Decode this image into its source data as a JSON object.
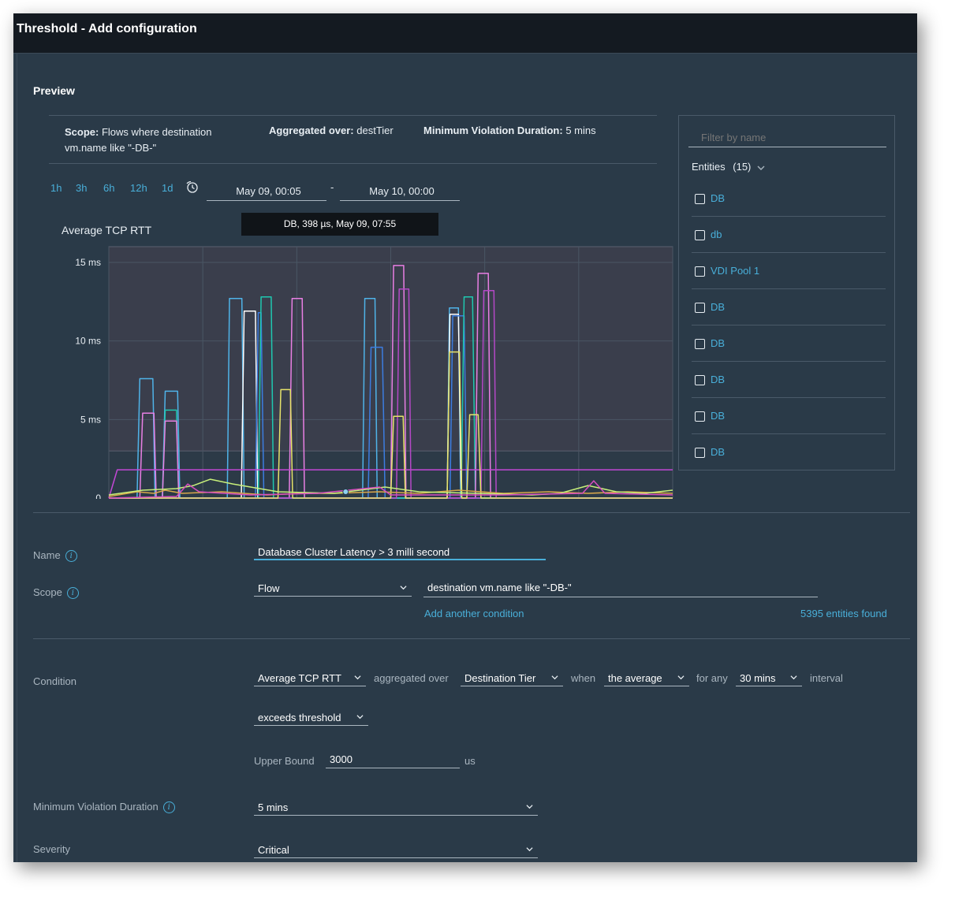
{
  "window": {
    "title": "Threshold - Add configuration"
  },
  "preview": {
    "title": "Preview",
    "summary": {
      "scope_label": "Scope:",
      "scope_value_line1": "Flows where destination",
      "scope_value_line2": "vm.name like \"-DB-\"",
      "aggregated_label": "Aggregated over:",
      "aggregated_value": "destTier",
      "min_violation_label": "Minimum Violation Duration:",
      "min_violation_value": "5 mins"
    },
    "time_ranges": [
      "1h",
      "3h",
      "6h",
      "12h",
      "1d"
    ],
    "time_icon": "clock-history-icon",
    "from_date": "May 09, 00:05",
    "range_separator": "-",
    "to_date": "May 10, 00:00",
    "tooltip": "DB, 398 µs, May 09, 07:55"
  },
  "entities": {
    "filter_placeholder": "Filter by name",
    "header_label": "Entities",
    "header_count": "(15)",
    "items": [
      {
        "label": "DB",
        "checked": false
      },
      {
        "label": "db",
        "checked": false
      },
      {
        "label": "VDI Pool 1",
        "checked": false
      },
      {
        "label": "DB",
        "checked": false
      },
      {
        "label": "DB",
        "checked": false
      },
      {
        "label": "DB",
        "checked": false
      },
      {
        "label": "DB",
        "checked": false
      },
      {
        "label": "DB",
        "checked": false
      }
    ]
  },
  "chart_data": {
    "type": "line",
    "title": "Average TCP RTT",
    "y_unit": "ms",
    "ylim": [
      0,
      16
    ],
    "y_ticks": [
      {
        "value": 0,
        "label": "0"
      },
      {
        "value": 5,
        "label": "5 ms"
      },
      {
        "value": 10,
        "label": "10 ms"
      },
      {
        "value": 15,
        "label": "15 ms"
      }
    ],
    "threshold": 3,
    "xlim": [
      0,
      100
    ],
    "grid": true,
    "series": [
      {
        "color": "#4fb3e8",
        "points": [
          [
            0,
            0
          ],
          [
            5,
            0
          ],
          [
            5.5,
            7.6
          ],
          [
            7.8,
            7.6
          ],
          [
            8.2,
            0
          ],
          [
            9.5,
            0
          ],
          [
            10,
            6.8
          ],
          [
            12.2,
            6.8
          ],
          [
            12.6,
            0
          ],
          [
            21,
            0
          ],
          [
            21.4,
            12.7
          ],
          [
            23.6,
            12.7
          ],
          [
            24,
            0
          ],
          [
            45,
            0
          ],
          [
            45.4,
            12.7
          ],
          [
            47.2,
            12.7
          ],
          [
            47.6,
            0
          ],
          [
            60,
            0
          ],
          [
            60.4,
            12.1
          ],
          [
            62,
            12.1
          ],
          [
            62.4,
            0
          ],
          [
            100,
            0
          ]
        ]
      },
      {
        "color": "#ffffff",
        "points": [
          [
            0,
            0
          ],
          [
            23.5,
            0
          ],
          [
            24,
            11.9
          ],
          [
            26,
            11.9
          ],
          [
            26.4,
            0
          ],
          [
            60,
            0
          ],
          [
            60.5,
            11.7
          ],
          [
            62,
            11.7
          ],
          [
            62.5,
            0
          ],
          [
            100,
            0
          ]
        ]
      },
      {
        "color": "#3c7de0",
        "points": [
          [
            0,
            0
          ],
          [
            26,
            0
          ],
          [
            26.5,
            11.8
          ],
          [
            27,
            11.8
          ],
          [
            27.5,
            0
          ],
          [
            46,
            0
          ],
          [
            46.5,
            9.6
          ],
          [
            48.5,
            9.6
          ],
          [
            49,
            0
          ],
          [
            60.5,
            0
          ],
          [
            61,
            11.6
          ],
          [
            63,
            11.6
          ],
          [
            63.5,
            0
          ],
          [
            100,
            0
          ]
        ]
      },
      {
        "color": "#1fc8b0",
        "points": [
          [
            0,
            0
          ],
          [
            9.5,
            0
          ],
          [
            10,
            5.6
          ],
          [
            12,
            5.6
          ],
          [
            12.4,
            0
          ],
          [
            26.5,
            0
          ],
          [
            27,
            12.8
          ],
          [
            28.8,
            12.8
          ],
          [
            29.2,
            0
          ],
          [
            62.5,
            0
          ],
          [
            63,
            12.8
          ],
          [
            64.5,
            12.8
          ],
          [
            65,
            0
          ],
          [
            100,
            0
          ]
        ]
      },
      {
        "color": "#e87fe3",
        "points": [
          [
            0,
            0
          ],
          [
            5.5,
            0
          ],
          [
            6,
            5.4
          ],
          [
            8,
            5.4
          ],
          [
            8.4,
            0
          ],
          [
            9.5,
            0
          ],
          [
            10,
            4.9
          ],
          [
            12,
            4.9
          ],
          [
            12.4,
            0
          ],
          [
            32,
            0
          ],
          [
            32.5,
            12.7
          ],
          [
            34.3,
            12.7
          ],
          [
            34.7,
            0
          ],
          [
            50,
            0
          ],
          [
            50.5,
            14.8
          ],
          [
            52.3,
            14.8
          ],
          [
            52.7,
            0
          ],
          [
            65,
            0
          ],
          [
            65.5,
            14.3
          ],
          [
            67.3,
            14.3
          ],
          [
            67.7,
            0
          ],
          [
            100,
            0
          ]
        ]
      },
      {
        "color": "#c347d6",
        "points": [
          [
            0,
            0
          ],
          [
            1.5,
            1.8
          ],
          [
            100,
            1.8
          ]
        ]
      },
      {
        "color": "#b448c6",
        "points": [
          [
            0,
            0
          ],
          [
            51,
            0
          ],
          [
            51.5,
            13.3
          ],
          [
            53.2,
            13.3
          ],
          [
            53.6,
            0
          ],
          [
            66,
            0
          ],
          [
            66.5,
            13.2
          ],
          [
            68.3,
            13.2
          ],
          [
            68.7,
            0
          ],
          [
            100,
            0
          ]
        ]
      },
      {
        "color": "#e7e36a",
        "points": [
          [
            0,
            0
          ],
          [
            30,
            0
          ],
          [
            30.5,
            6.9
          ],
          [
            32.2,
            6.9
          ],
          [
            32.6,
            0
          ],
          [
            50,
            0
          ],
          [
            50.5,
            5.2
          ],
          [
            52.2,
            5.2
          ],
          [
            52.6,
            0
          ],
          [
            60,
            0
          ],
          [
            60.4,
            9.3
          ],
          [
            62.2,
            9.3
          ],
          [
            62.6,
            0
          ],
          [
            63.5,
            0
          ],
          [
            64,
            5.3
          ],
          [
            65.5,
            5.3
          ],
          [
            66,
            0
          ],
          [
            100,
            0
          ]
        ]
      },
      {
        "color": "#d9a84a",
        "points": [
          [
            0,
            0.1
          ],
          [
            5,
            0.4
          ],
          [
            8,
            0.3
          ],
          [
            10,
            0.5
          ],
          [
            13,
            0.3
          ],
          [
            20,
            0.4
          ],
          [
            28,
            0.2
          ],
          [
            34,
            0.3
          ],
          [
            40,
            0.3
          ],
          [
            48,
            0.4
          ],
          [
            55,
            0.3
          ],
          [
            62,
            0.5
          ],
          [
            70,
            0.3
          ],
          [
            78,
            0.4
          ],
          [
            85,
            0.3
          ],
          [
            92,
            0.4
          ],
          [
            100,
            0.3
          ]
        ]
      },
      {
        "color": "#c8f07a",
        "points": [
          [
            0,
            0.2
          ],
          [
            6,
            0.5
          ],
          [
            12,
            0.6
          ],
          [
            15,
            0.8
          ],
          [
            18,
            1.2
          ],
          [
            22,
            0.9
          ],
          [
            30,
            0.4
          ],
          [
            40,
            0.3
          ],
          [
            49,
            0.7
          ],
          [
            55,
            0.4
          ],
          [
            65,
            0.3
          ],
          [
            75,
            0.2
          ],
          [
            80,
            0.3
          ],
          [
            85,
            0.8
          ],
          [
            90,
            0.4
          ],
          [
            95,
            0.3
          ],
          [
            100,
            0.5
          ]
        ]
      },
      {
        "color": "#d84ec0",
        "points": [
          [
            0,
            0
          ],
          [
            12,
            0.1
          ],
          [
            14,
            0.9
          ],
          [
            16,
            0.4
          ],
          [
            25,
            0.2
          ],
          [
            37,
            0.3
          ],
          [
            48,
            0.7
          ],
          [
            50,
            0.2
          ],
          [
            70,
            0.2
          ],
          [
            84,
            0.3
          ],
          [
            86,
            1.1
          ],
          [
            88,
            0.3
          ],
          [
            100,
            0.2
          ]
        ]
      }
    ]
  },
  "form": {
    "name": {
      "label": "Name",
      "value": "Database Cluster Latency > 3 milli second"
    },
    "scope": {
      "label": "Scope",
      "type_value": "Flow",
      "condition_value": "destination vm.name like \"-DB-\"",
      "add_condition": "Add another condition",
      "entities_found": "5395 entities found"
    },
    "condition": {
      "label": "Condition",
      "metric": "Average TCP RTT",
      "aggregated_over_text": "aggregated over",
      "tier": "Destination Tier",
      "when_text": "when",
      "average": "the average",
      "for_any_text": "for any",
      "interval_value": "30 mins",
      "interval_text": "interval",
      "threshold_type": "exceeds threshold",
      "upper_bound_label": "Upper Bound",
      "upper_bound_value": "3000",
      "upper_bound_unit": "us"
    },
    "min_violation": {
      "label": "Minimum Violation Duration",
      "value": "5 mins"
    },
    "severity": {
      "label": "Severity",
      "value": "Critical"
    }
  },
  "colors": {
    "accent": "#49afd9",
    "panel_bg": "#2a3a48",
    "titlebar_bg": "#141a21"
  }
}
